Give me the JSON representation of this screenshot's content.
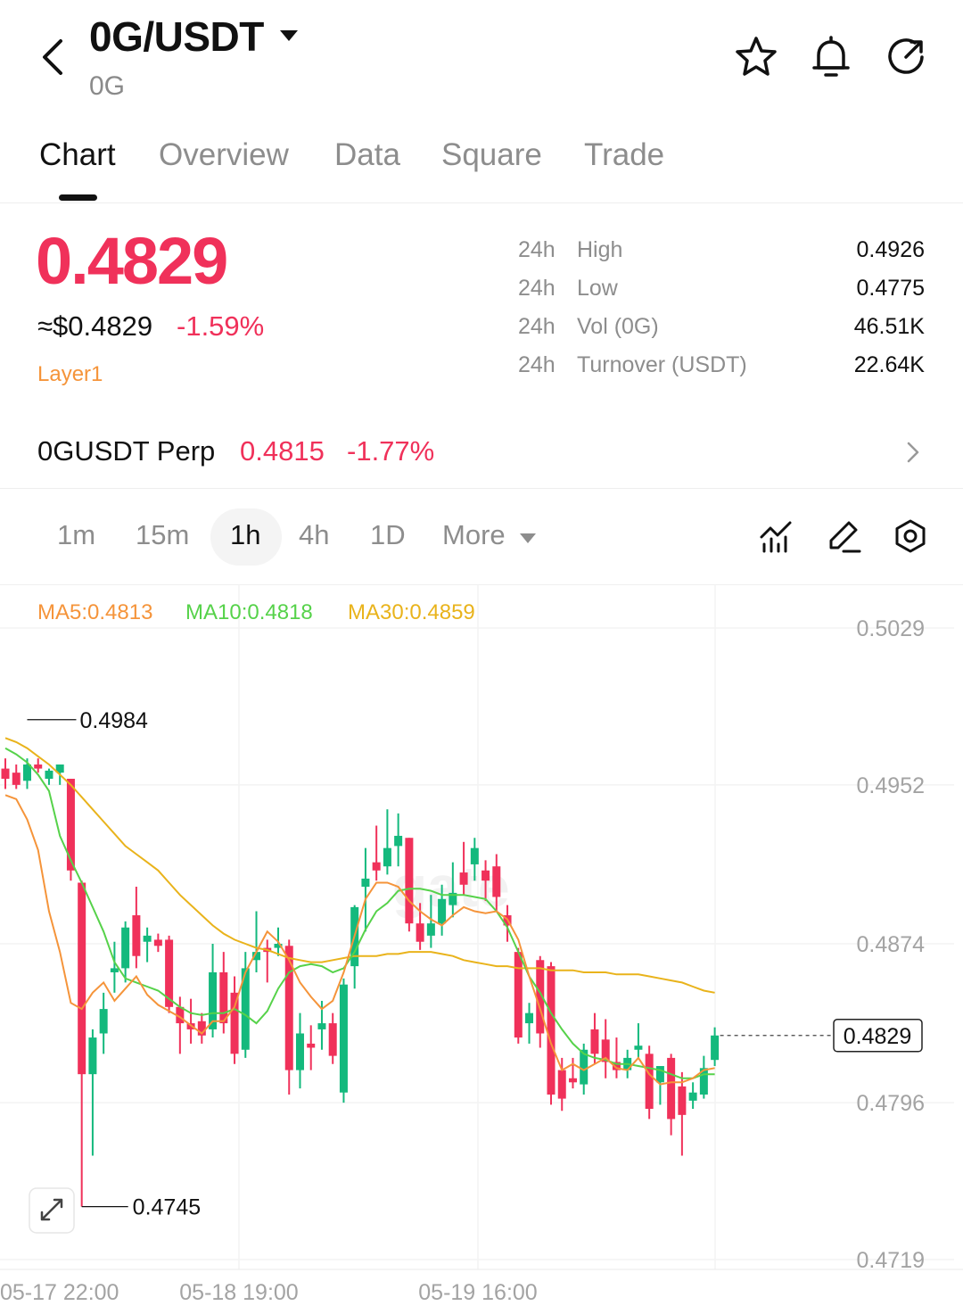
{
  "header": {
    "pair": "0G/USDT",
    "base": "0G"
  },
  "tabs": [
    "Chart",
    "Overview",
    "Data",
    "Square",
    "Trade"
  ],
  "ticker": {
    "price": "0.4829",
    "usd_price": "≈$0.4829",
    "change_pct": "-1.59%",
    "tag": "Layer1"
  },
  "stats": [
    {
      "period": "24h",
      "label": "High",
      "value": "0.4926"
    },
    {
      "period": "24h",
      "label": "Low",
      "value": "0.4775"
    },
    {
      "period": "24h",
      "label": "Vol (0G)",
      "value": "46.51K"
    },
    {
      "period": "24h",
      "label": "Turnover (USDT)",
      "value": "22.64K"
    }
  ],
  "perp": {
    "name": "0GUSDT Perp",
    "price": "0.4815",
    "change_pct": "-1.77%"
  },
  "intervals": [
    "1m",
    "15m",
    "1h",
    "4h",
    "1D",
    "More"
  ],
  "selected_interval": "1h",
  "ma_labels": {
    "ma5": "MA5:0.4813",
    "ma10": "MA10:0.4818",
    "ma30": "MA30:0.4859"
  },
  "colors": {
    "up": "#14b97d",
    "down": "#f0315a",
    "ma5": "#f5943a",
    "ma10": "#56d24a",
    "ma30": "#e9b31b",
    "tag": "#f5943a"
  },
  "chart_data": {
    "type": "candlestick",
    "interval": "1h",
    "y_axis_ticks": [
      "0.5029",
      "0.4952",
      "0.4874",
      "0.4796",
      "0.4719"
    ],
    "x_axis_ticks": [
      "05-17 22:00",
      "05-18 19:00",
      "05-19 16:00"
    ],
    "ylim": [
      0.4719,
      0.5029
    ],
    "last_price_label": "0.4829",
    "max_label": "0.4984",
    "min_label": "0.4745",
    "candles": [
      [
        0.496,
        0.4965,
        0.495,
        0.4955
      ],
      [
        0.4958,
        0.4962,
        0.495,
        0.4952
      ],
      [
        0.4954,
        0.4965,
        0.495,
        0.4962
      ],
      [
        0.4962,
        0.4965,
        0.4958,
        0.496
      ],
      [
        0.4955,
        0.496,
        0.4952,
        0.4959
      ],
      [
        0.4958,
        0.4962,
        0.4952,
        0.4962
      ],
      [
        0.4955,
        0.4955,
        0.4905,
        0.491
      ],
      [
        0.4904,
        0.4905,
        0.4745,
        0.481
      ],
      [
        0.481,
        0.4832,
        0.477,
        0.4828
      ],
      [
        0.483,
        0.485,
        0.482,
        0.4842
      ],
      [
        0.486,
        0.4875,
        0.485,
        0.4862
      ],
      [
        0.4862,
        0.4885,
        0.4855,
        0.4882
      ],
      [
        0.4888,
        0.4902,
        0.4862,
        0.4868
      ],
      [
        0.4875,
        0.4882,
        0.4865,
        0.4878
      ],
      [
        0.4876,
        0.4879,
        0.487,
        0.4873
      ],
      [
        0.4876,
        0.4878,
        0.484,
        0.4843
      ],
      [
        0.4843,
        0.4848,
        0.482,
        0.4835
      ],
      [
        0.4835,
        0.4847,
        0.4825,
        0.4832
      ],
      [
        0.4836,
        0.484,
        0.4825,
        0.4829
      ],
      [
        0.4832,
        0.4874,
        0.4828,
        0.486
      ],
      [
        0.486,
        0.487,
        0.483,
        0.4835
      ],
      [
        0.485,
        0.4858,
        0.4815,
        0.482
      ],
      [
        0.4822,
        0.487,
        0.4818,
        0.4862
      ],
      [
        0.4866,
        0.489,
        0.486,
        0.487
      ],
      [
        0.4872,
        0.4876,
        0.4855,
        0.487
      ],
      [
        0.4872,
        0.4882,
        0.4868,
        0.4874
      ],
      [
        0.4873,
        0.4876,
        0.48,
        0.4812
      ],
      [
        0.4812,
        0.484,
        0.4803,
        0.483
      ],
      [
        0.4825,
        0.4834,
        0.4812,
        0.4823
      ],
      [
        0.4832,
        0.4846,
        0.4822,
        0.4835
      ],
      [
        0.4835,
        0.484,
        0.4815,
        0.4819
      ],
      [
        0.4801,
        0.4857,
        0.4796,
        0.4854
      ],
      [
        0.4863,
        0.4893,
        0.4852,
        0.4892
      ],
      [
        0.4902,
        0.4921,
        0.488,
        0.4906
      ],
      [
        0.4914,
        0.4932,
        0.4905,
        0.491
      ],
      [
        0.4912,
        0.494,
        0.4908,
        0.4921
      ],
      [
        0.4922,
        0.4938,
        0.4912,
        0.4927
      ],
      [
        0.4926,
        0.4926,
        0.488,
        0.4884
      ],
      [
        0.4884,
        0.4894,
        0.4871,
        0.4875
      ],
      [
        0.4878,
        0.4898,
        0.4872,
        0.4884
      ],
      [
        0.4884,
        0.4903,
        0.4878,
        0.4896
      ],
      [
        0.4893,
        0.4914,
        0.4887,
        0.4899
      ],
      [
        0.4909,
        0.4924,
        0.4898,
        0.4903
      ],
      [
        0.4913,
        0.4926,
        0.4905,
        0.4921
      ],
      [
        0.491,
        0.4915,
        0.4895,
        0.4905
      ],
      [
        0.4912,
        0.4918,
        0.489,
        0.4897
      ],
      [
        0.4888,
        0.4893,
        0.4875,
        0.4883
      ],
      [
        0.487,
        0.4872,
        0.4825,
        0.4828
      ],
      [
        0.4835,
        0.4845,
        0.4825,
        0.484
      ],
      [
        0.4866,
        0.4868,
        0.4823,
        0.483
      ],
      [
        0.4863,
        0.4865,
        0.4795,
        0.48
      ],
      [
        0.4812,
        0.4818,
        0.4792,
        0.4798
      ],
      [
        0.4808,
        0.4818,
        0.4803,
        0.4806
      ],
      [
        0.4805,
        0.4825,
        0.48,
        0.4822
      ],
      [
        0.4832,
        0.484,
        0.4815,
        0.482
      ],
      [
        0.4827,
        0.4837,
        0.4808,
        0.4816
      ],
      [
        0.4816,
        0.4828,
        0.4808,
        0.4812
      ],
      [
        0.4812,
        0.4822,
        0.4808,
        0.4818
      ],
      [
        0.4822,
        0.4835,
        0.4818,
        0.4824
      ],
      [
        0.482,
        0.4824,
        0.4788,
        0.4793
      ],
      [
        0.4806,
        0.4813,
        0.4795,
        0.4814
      ],
      [
        0.4818,
        0.482,
        0.478,
        0.4788
      ],
      [
        0.4804,
        0.4811,
        0.477,
        0.479
      ],
      [
        0.4797,
        0.4806,
        0.4793,
        0.4801
      ],
      [
        0.48,
        0.4819,
        0.4798,
        0.4813
      ],
      [
        0.4817,
        0.4833,
        0.4814,
        0.4829
      ]
    ],
    "ma5": [
      0.4947,
      0.4945,
      0.4935,
      0.492,
      0.489,
      0.487,
      0.4845,
      0.4842,
      0.485,
      0.4855,
      0.4846,
      0.4852,
      0.4858,
      0.4849,
      0.4844,
      0.4841,
      0.4838,
      0.4834,
      0.483,
      0.4836,
      0.4836,
      0.4843,
      0.486,
      0.487,
      0.488,
      0.4875,
      0.4866,
      0.4855,
      0.4848,
      0.4842,
      0.4846,
      0.486,
      0.4878,
      0.4896,
      0.4904,
      0.4904,
      0.4902,
      0.4895,
      0.489,
      0.4886,
      0.4883,
      0.4888,
      0.4892,
      0.489,
      0.4889,
      0.489,
      0.4886,
      0.4876,
      0.4858,
      0.4842,
      0.4825,
      0.4812,
      0.4815,
      0.4812,
      0.4815,
      0.4818,
      0.4813,
      0.4812,
      0.4818,
      0.481,
      0.4805,
      0.4806,
      0.4806,
      0.4808,
      0.4812,
      0.4813
    ],
    "ma10": [
      0.497,
      0.4967,
      0.4963,
      0.4957,
      0.4949,
      0.4927,
      0.4915,
      0.4904,
      0.4892,
      0.488,
      0.4865,
      0.4857,
      0.4855,
      0.4853,
      0.4851,
      0.4847,
      0.4843,
      0.484,
      0.4839,
      0.484,
      0.484,
      0.4842,
      0.4839,
      0.4835,
      0.4841,
      0.4852,
      0.486,
      0.4863,
      0.4864,
      0.4863,
      0.486,
      0.4862,
      0.487,
      0.4881,
      0.489,
      0.4894,
      0.49,
      0.4901,
      0.4901,
      0.49,
      0.4898,
      0.4898,
      0.4898,
      0.4897,
      0.4896,
      0.489,
      0.4882,
      0.487,
      0.4858,
      0.485,
      0.484,
      0.4832,
      0.4825,
      0.482,
      0.4818,
      0.4817,
      0.4815,
      0.4815,
      0.4814,
      0.4813,
      0.4812,
      0.481,
      0.4808,
      0.4808,
      0.481,
      0.481
    ],
    "ma30": [
      0.4975,
      0.4973,
      0.497,
      0.4966,
      0.4962,
      0.4957,
      0.4952,
      0.4946,
      0.494,
      0.4934,
      0.4928,
      0.4922,
      0.4918,
      0.4914,
      0.491,
      0.4904,
      0.4898,
      0.4893,
      0.4888,
      0.4883,
      0.4879,
      0.4876,
      0.4874,
      0.4872,
      0.4871,
      0.4869,
      0.4867,
      0.4866,
      0.4865,
      0.4865,
      0.4866,
      0.4867,
      0.4868,
      0.4868,
      0.4868,
      0.4869,
      0.4869,
      0.487,
      0.487,
      0.487,
      0.4869,
      0.4868,
      0.4866,
      0.4865,
      0.4864,
      0.4863,
      0.4863,
      0.4862,
      0.4862,
      0.4862,
      0.4861,
      0.4861,
      0.4861,
      0.486,
      0.486,
      0.486,
      0.4859,
      0.4859,
      0.4859,
      0.4858,
      0.4857,
      0.4856,
      0.4855,
      0.4853,
      0.4851,
      0.485
    ]
  }
}
